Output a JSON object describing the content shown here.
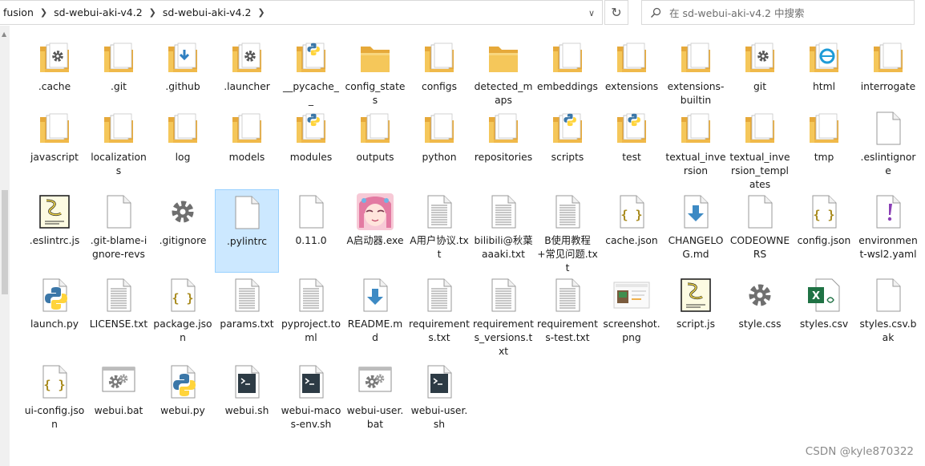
{
  "address_bar": {
    "crumbs": [
      "fusion",
      "sd-webui-aki-v4.2",
      "sd-webui-aki-v4.2"
    ]
  },
  "search": {
    "placeholder": "在 sd-webui-aki-v4.2 中搜索"
  },
  "watermark": "CSDN @kyle870322",
  "colors": {
    "folder": "#f5c75a",
    "folder_dark": "#e6a93a",
    "selection": "#cce8ff",
    "python_blue": "#3b77a8",
    "python_yellow": "#ffd43b"
  },
  "rows": [
    [
      {
        "name": ".cache",
        "icon": "folder-gear-icon"
      },
      {
        "name": ".git",
        "icon": "folder-doc-icon"
      },
      {
        "name": ".github",
        "icon": "folder-download-icon"
      },
      {
        "name": ".launcher",
        "icon": "folder-gear-icon"
      },
      {
        "name": "__pycache__",
        "icon": "folder-python-icon"
      },
      {
        "name": "config_states",
        "icon": "folder-icon"
      },
      {
        "name": "configs",
        "icon": "folder-doc-icon"
      },
      {
        "name": "detected_maps",
        "icon": "folder-icon"
      },
      {
        "name": "embeddings",
        "icon": "folder-doc-icon"
      },
      {
        "name": "extensions",
        "icon": "folder-doc-icon"
      },
      {
        "name": "extensions-builtin",
        "icon": "folder-doc-icon"
      },
      {
        "name": "git",
        "icon": "folder-gear-icon"
      },
      {
        "name": "html",
        "icon": "folder-ie-icon"
      },
      {
        "name": "interrogate",
        "icon": "folder-doc-icon"
      }
    ],
    [
      {
        "name": "javascript",
        "icon": "folder-doc-icon"
      },
      {
        "name": "localizations",
        "icon": "folder-doc-icon"
      },
      {
        "name": "log",
        "icon": "folder-doc-icon"
      },
      {
        "name": "models",
        "icon": "folder-doc-icon"
      },
      {
        "name": "modules",
        "icon": "folder-python-icon"
      },
      {
        "name": "outputs",
        "icon": "folder-doc-icon"
      },
      {
        "name": "python",
        "icon": "folder-doc-icon"
      },
      {
        "name": "repositories",
        "icon": "folder-doc-icon"
      },
      {
        "name": "scripts",
        "icon": "folder-python-icon"
      },
      {
        "name": "test",
        "icon": "folder-python-icon"
      },
      {
        "name": "textual_inversion",
        "icon": "folder-doc-icon"
      },
      {
        "name": "textual_inversion_templates",
        "icon": "folder-doc-icon"
      },
      {
        "name": "tmp",
        "icon": "folder-doc-icon"
      },
      {
        "name": ".eslintignore",
        "icon": "file-blank-icon"
      }
    ],
    [
      {
        "name": ".eslintrc.js",
        "icon": "script-scroll-icon"
      },
      {
        "name": ".git-blame-ignore-revs",
        "icon": "file-blank-icon"
      },
      {
        "name": ".gitignore",
        "icon": "file-gear-icon"
      },
      {
        "name": ".pylintrc",
        "icon": "file-blank-icon",
        "selected": true
      },
      {
        "name": "0.11.0",
        "icon": "file-blank-icon"
      },
      {
        "name": "A启动器.exe",
        "icon": "anime-app-icon"
      },
      {
        "name": "A用户协议.txt",
        "icon": "file-text-icon"
      },
      {
        "name": "bilibili@秋葉aaaki.txt",
        "icon": "file-text-icon"
      },
      {
        "name": "B使用教程+常见问题.txt",
        "icon": "file-text-icon"
      },
      {
        "name": "cache.json",
        "icon": "file-json-icon"
      },
      {
        "name": "CHANGELOG.md",
        "icon": "file-md-icon"
      },
      {
        "name": "CODEOWNERS",
        "icon": "file-blank-icon"
      },
      {
        "name": "config.json",
        "icon": "file-json-icon"
      },
      {
        "name": "environment-wsl2.yaml",
        "icon": "file-exclaim-icon"
      }
    ],
    [
      {
        "name": "launch.py",
        "icon": "file-python-icon"
      },
      {
        "name": "LICENSE.txt",
        "icon": "file-text-icon"
      },
      {
        "name": "package.json",
        "icon": "file-json-icon"
      },
      {
        "name": "params.txt",
        "icon": "file-text-icon"
      },
      {
        "name": "pyproject.toml",
        "icon": "file-text-icon"
      },
      {
        "name": "README.md",
        "icon": "file-md-icon"
      },
      {
        "name": "requirements.txt",
        "icon": "file-text-icon"
      },
      {
        "name": "requirements_versions.txt",
        "icon": "file-text-icon"
      },
      {
        "name": "requirements-test.txt",
        "icon": "file-text-icon"
      },
      {
        "name": "screenshot.png",
        "icon": "image-thumb-icon"
      },
      {
        "name": "script.js",
        "icon": "script-scroll-icon"
      },
      {
        "name": "style.css",
        "icon": "file-gear-icon"
      },
      {
        "name": "styles.csv",
        "icon": "excel-icon"
      },
      {
        "name": "styles.csv.bak",
        "icon": "file-blank-icon"
      }
    ],
    [
      {
        "name": "ui-config.json",
        "icon": "file-json-icon"
      },
      {
        "name": "webui.bat",
        "icon": "batch-gear-icon"
      },
      {
        "name": "webui.py",
        "icon": "file-python-icon"
      },
      {
        "name": "webui.sh",
        "icon": "file-terminal-icon"
      },
      {
        "name": "webui-macos-env.sh",
        "icon": "file-terminal-icon"
      },
      {
        "name": "webui-user.bat",
        "icon": "batch-gear-icon"
      },
      {
        "name": "webui-user.sh",
        "icon": "file-terminal-icon"
      }
    ]
  ]
}
